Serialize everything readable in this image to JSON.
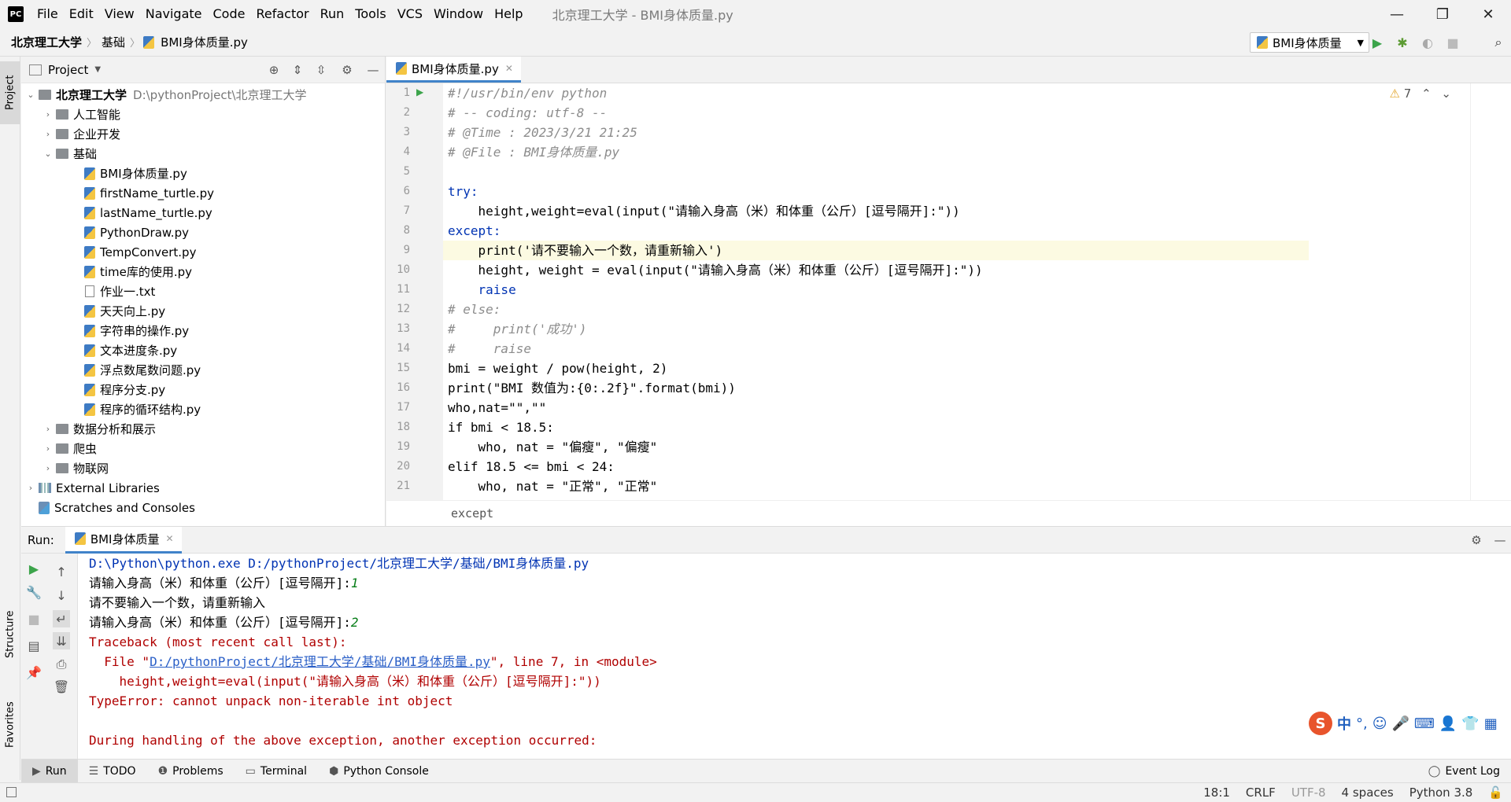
{
  "app": {
    "logo": "PC",
    "menu": [
      "File",
      "Edit",
      "View",
      "Navigate",
      "Code",
      "Refactor",
      "Run",
      "Tools",
      "VCS",
      "Window",
      "Help"
    ],
    "window_title": "北京理工大学 - BMI身体质量.py"
  },
  "window_controls": {
    "minimize": "—",
    "restore": "❐",
    "close": "✕"
  },
  "navbar": {
    "breadcrumb": [
      "北京理工大学",
      "基础",
      "BMI身体质量.py"
    ],
    "run_config": "BMI身体质量"
  },
  "left_strip": {
    "project_tab": "Project",
    "structure_tab": "Structure",
    "favorites_tab": "Favorites"
  },
  "project_panel": {
    "title": "Project",
    "root": {
      "name": "北京理工大学",
      "path": "D:\\pythonProject\\北京理工大学"
    },
    "folders_top": [
      "人工智能",
      "企业开发"
    ],
    "open_folder": "基础",
    "files": [
      "BMI身体质量.py",
      "firstName_turtle.py",
      "lastName_turtle.py",
      "PythonDraw.py",
      "TempConvert.py",
      "time库的使用.py",
      "作业一.txt",
      "天天向上.py",
      "字符串的操作.py",
      "文本进度条.py",
      "浮点数尾数问题.py",
      "程序分支.py",
      "程序的循环结构.py"
    ],
    "folders_bottom": [
      "数据分析和展示",
      "爬虫",
      "物联网"
    ],
    "external_libraries": "External Libraries",
    "scratches": "Scratches and Consoles"
  },
  "editor": {
    "tab": "BMI身体质量.py",
    "warning_count": "7",
    "breadcrumb": "except",
    "line_numbers": [
      "1",
      "2",
      "3",
      "4",
      "5",
      "6",
      "7",
      "8",
      "9",
      "10",
      "11",
      "12",
      "13",
      "14",
      "15",
      "16",
      "17",
      "18",
      "19",
      "20",
      "21"
    ],
    "lines": [
      "#!/usr/bin/env python",
      "# -- coding: utf-8 --",
      "# @Time : 2023/3/21 21:25",
      "# @File : BMI身体质量.py",
      "",
      "try:",
      "    height,weight=eval(input(\"请输入身高（米）和体重（公斤）[逗号隔开]:\"))",
      "except:",
      "    print('请不要输入一个数，请重新输入')",
      "    height, weight = eval(input(\"请输入身高（米）和体重（公斤）[逗号隔开]:\"))",
      "    raise",
      "# else:",
      "#     print('成功')",
      "#     raise",
      "bmi = weight / pow(height, 2)",
      "print(\"BMI 数值为:{0:.2f}\".format(bmi))",
      "who,nat=\"\",\"\"",
      "if bmi < 18.5:",
      "    who, nat = \"偏瘦\", \"偏瘦\"",
      "elif 18.5 <= bmi < 24:",
      "    who, nat = \"正常\", \"正常\""
    ]
  },
  "run_panel": {
    "label": "Run:",
    "tab": "BMI身体质量",
    "console": {
      "cmd": "D:\\Python\\python.exe D:/pythonProject/北京理工大学/基础/BMI身体质量.py",
      "prompt1": "请输入身高（米）和体重（公斤）[逗号隔开]:",
      "input1": "1",
      "msg": "请不要输入一个数，请重新输入",
      "prompt2": "请输入身高（米）和体重（公斤）[逗号隔开]:",
      "input2": "2",
      "traceback": "Traceback (most recent call last):",
      "file_prefix": "  File \"",
      "file_link": "D:/pythonProject/北京理工大学/基础/BMI身体质量.py",
      "file_suffix": "\", line 7, in <module>",
      "src_line": "    height,weight=eval(input(\"请输入身高（米）和体重（公斤）[逗号隔开]:\"))",
      "error": "TypeError: cannot unpack non-iterable int object",
      "during": "During handling of the above exception, another exception occurred:"
    }
  },
  "bottom_tabs": [
    "Run",
    "TODO",
    "Problems",
    "Terminal",
    "Python Console"
  ],
  "event_log": "Event Log",
  "status_bar": {
    "position": "18:1",
    "line_sep": "CRLF",
    "encoding": "UTF-8",
    "indent": "4 spaces",
    "interpreter": "Python 3.8"
  },
  "ime": {
    "lang": "中",
    "punct": "°,"
  }
}
